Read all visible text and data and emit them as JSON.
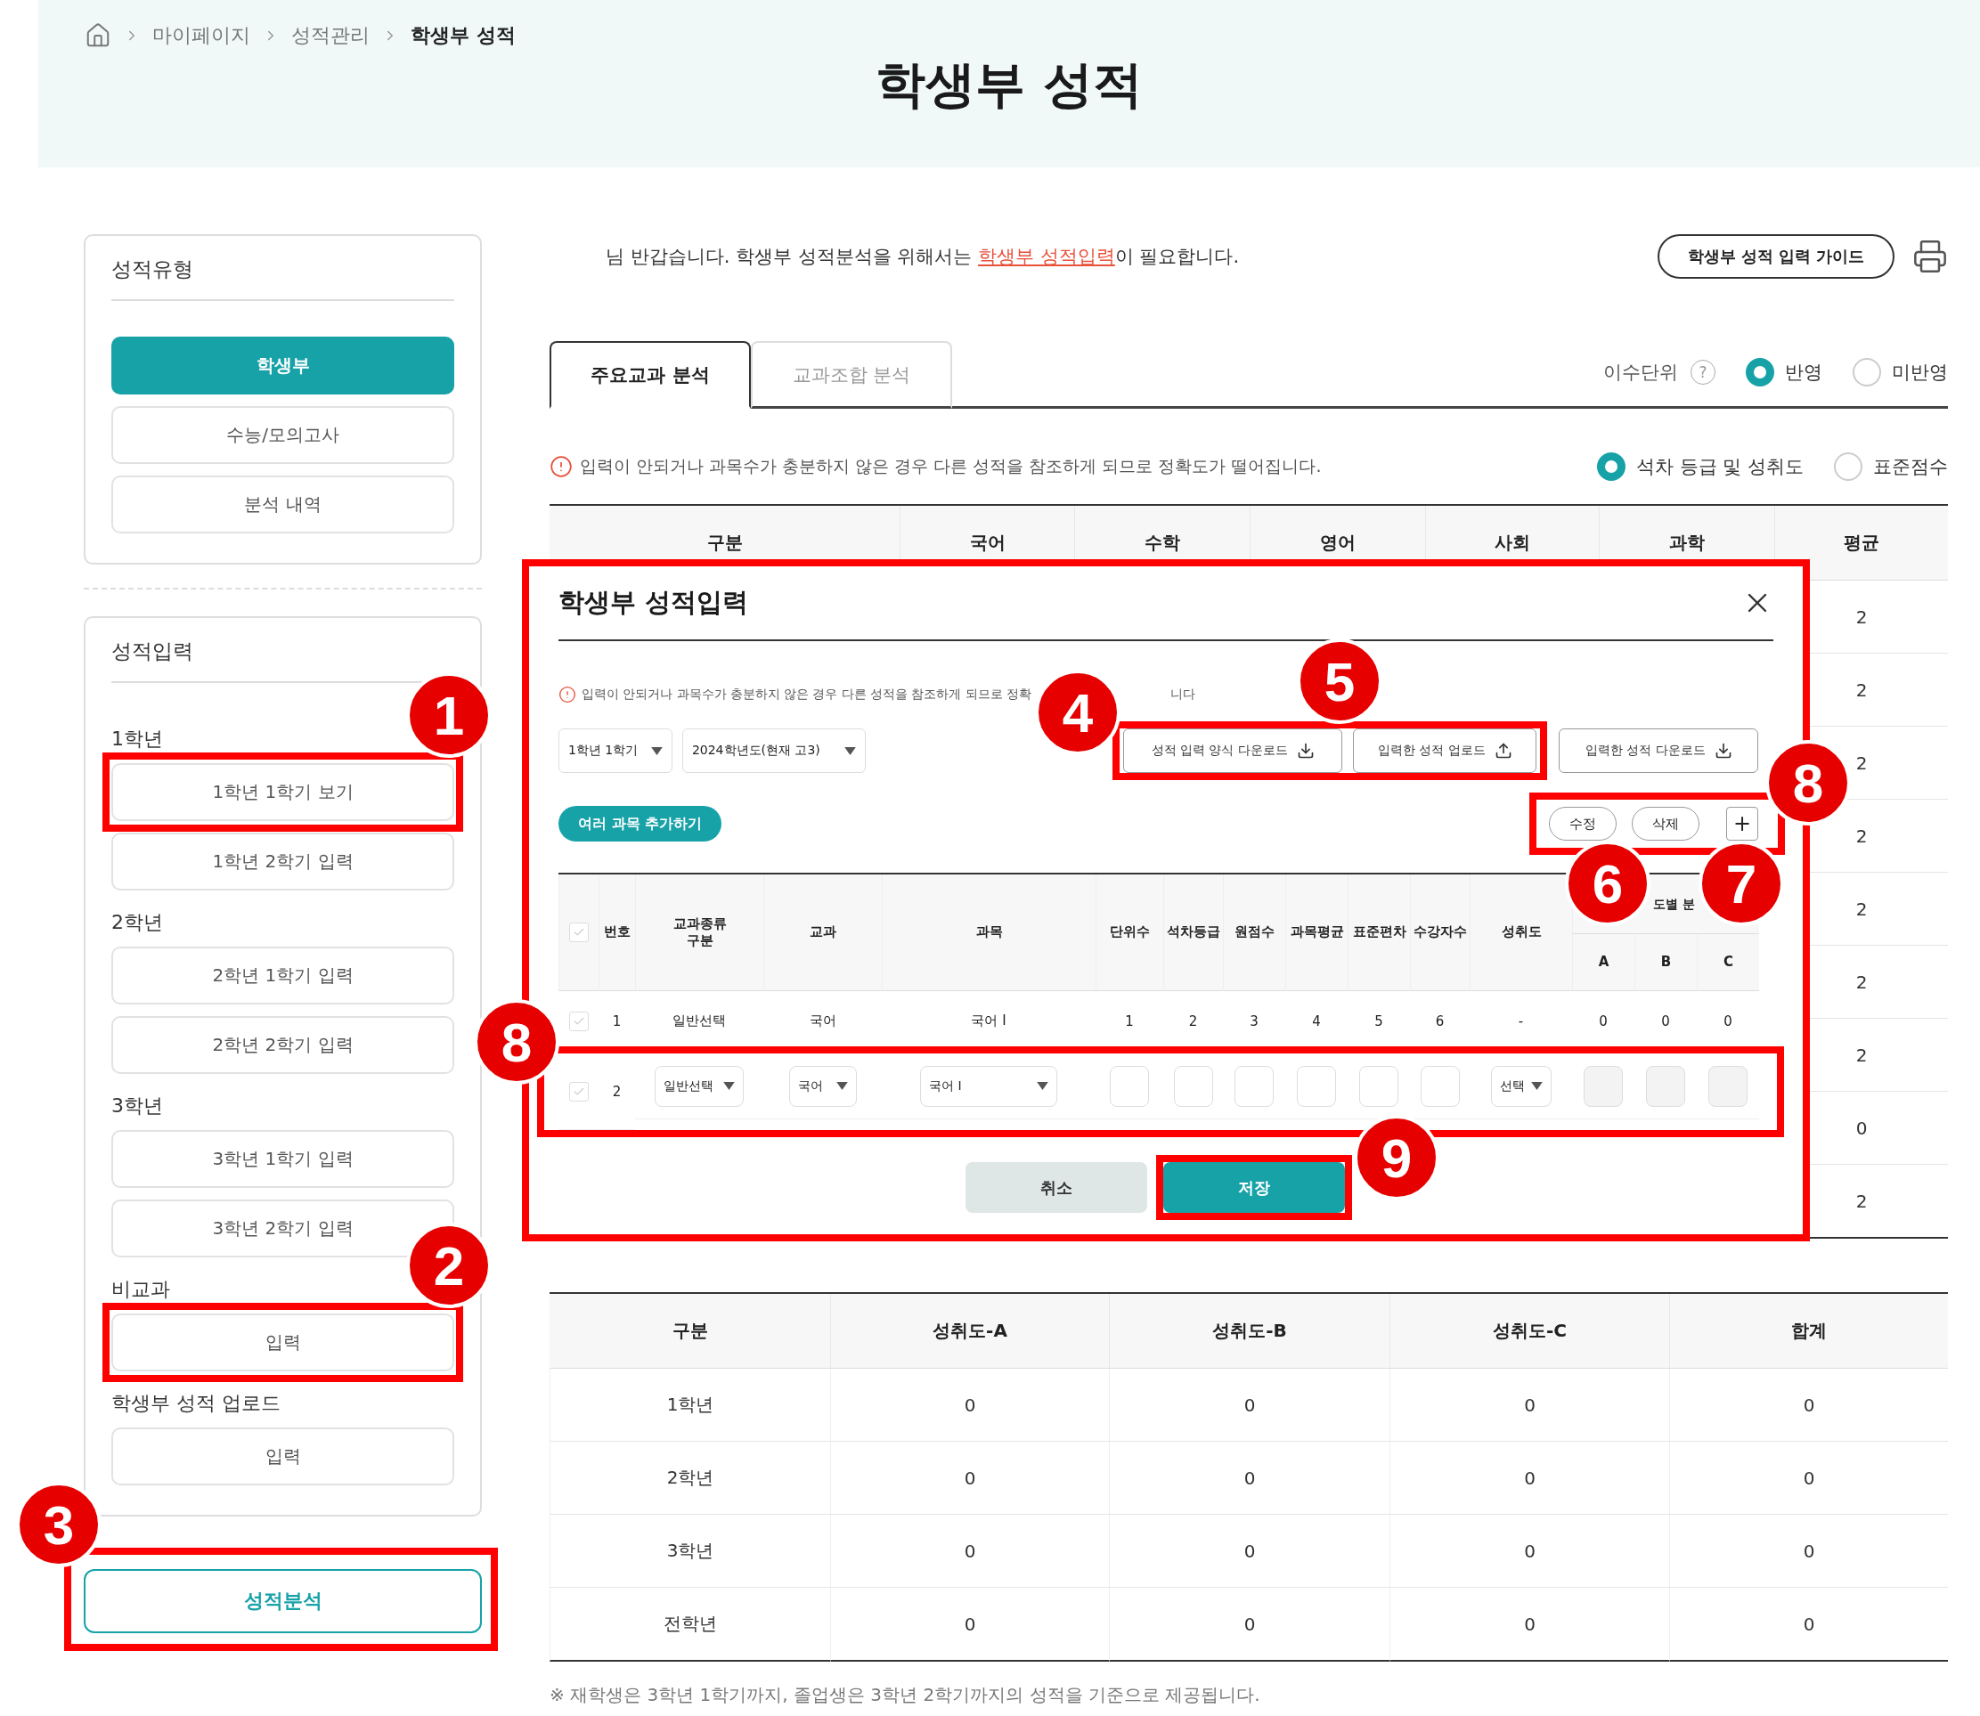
{
  "breadcrumb": [
    "마이페이지",
    "성적관리",
    "학생부 성적"
  ],
  "page_title": "학생부 성적",
  "sidebar": {
    "type_menu": {
      "title": "성적유형",
      "items": [
        {
          "label": "학생부",
          "selected": true
        },
        {
          "label": "수능/모의고사",
          "selected": false
        },
        {
          "label": "분석 내역",
          "selected": false
        }
      ]
    },
    "input_menu": {
      "title": "성적입력",
      "groups": [
        {
          "heading": "1학년",
          "items": [
            "1학년 1학기 보기",
            "1학년 2학기 입력"
          ]
        },
        {
          "heading": "2학년",
          "items": [
            "2학년 1학기 입력",
            "2학년 2학기 입력"
          ]
        },
        {
          "heading": "3학년",
          "items": [
            "3학년 1학기 입력",
            "3학년 2학기 입력"
          ]
        },
        {
          "heading": "비교과",
          "items": [
            "입력"
          ]
        },
        {
          "heading": "학생부 성적 업로드",
          "items": [
            "입력"
          ]
        }
      ]
    },
    "analysis_button": "성적분석"
  },
  "welcome": {
    "text_before": "님 반갑습니다. 학생부 성적분석을 위해서는 ",
    "link": "학생부 성적입력",
    "text_after": "이 필요합니다."
  },
  "guide_button": "학생부 성적 입력 가이드",
  "tabs": [
    {
      "label": "주요교과 분석",
      "selected": true
    },
    {
      "label": "교과조합 분석",
      "selected": false
    }
  ],
  "credit_option": {
    "label": "이수단위",
    "help": "?",
    "options": [
      {
        "label": "반영",
        "selected": true
      },
      {
        "label": "미반영",
        "selected": false
      }
    ]
  },
  "notice": "입력이 안되거나 과목수가 충분하지 않은 경우 다른 성적을 참조하게 되므로 정확도가 떨어집니다.",
  "score_option": {
    "options": [
      {
        "label": "석차 등급 및 성취도",
        "selected": true
      },
      {
        "label": "표준점수",
        "selected": false
      }
    ]
  },
  "subject_table": {
    "columns": [
      "구분",
      "국어",
      "수학",
      "영어",
      "사회",
      "과학",
      "평균"
    ],
    "rows": [
      {
        "average": "2"
      },
      {
        "average": "2"
      },
      {
        "average": "2"
      },
      {
        "average": "2"
      },
      {
        "average": "2"
      },
      {
        "average": "2"
      },
      {
        "average": "2"
      },
      {
        "average": "0"
      },
      {
        "average": "2"
      }
    ]
  },
  "modal": {
    "title": "학생부 성적입력",
    "warning": [
      "입력이 안되거나 과목수가 충분하지 않은 경우 다른 성적을 참조하게 되므로 정확",
      "니다"
    ],
    "selects": [
      "1학년 1학기",
      "2024학년도(현재 고3)"
    ],
    "file_buttons": [
      {
        "label": "성적 입력 양식 다운로드",
        "kind": "download"
      },
      {
        "label": "입력한 성적 업로드",
        "kind": "upload"
      },
      {
        "label": "입력한 성적 다운로드",
        "kind": "download"
      }
    ],
    "add_button": "여러 과목 추가하기",
    "row_actions": [
      {
        "label": "수정",
        "kind": "text"
      },
      {
        "label": "삭제",
        "kind": "text"
      },
      {
        "label": "+",
        "kind": "icon"
      }
    ],
    "columns": [
      "번호",
      "교과종류\n구분",
      "교과",
      "과목",
      "단위수",
      "석차등급",
      "원점수",
      "과목평균",
      "표준편차",
      "수강자수",
      "성취도"
    ],
    "group_header": "도별 분",
    "sub_columns": [
      "A",
      "B",
      "C"
    ],
    "rows": [
      {
        "kind": "view",
        "checked": false,
        "number": "1",
        "cells": [
          "일반선택",
          "국어",
          "국어 I",
          "1",
          "2",
          "3",
          "4",
          "5",
          "6",
          "-",
          "0",
          "0",
          "0"
        ]
      },
      {
        "kind": "edit",
        "checked": false,
        "number": "2",
        "selects": [
          "일반선택",
          "국어",
          "국어 I"
        ],
        "achievement": "선택"
      }
    ],
    "buttons": [
      {
        "label": "취소",
        "kind": "secondary"
      },
      {
        "label": "저장",
        "kind": "primary"
      }
    ]
  },
  "achievement_table": {
    "columns": [
      "구분",
      "성취도-A",
      "성취도-B",
      "성취도-C",
      "합계"
    ],
    "rows": [
      [
        "1학년",
        "0",
        "0",
        "0",
        "0"
      ],
      [
        "2학년",
        "0",
        "0",
        "0",
        "0"
      ],
      [
        "3학년",
        "0",
        "0",
        "0",
        "0"
      ],
      [
        "전학년",
        "0",
        "0",
        "0",
        "0"
      ]
    ]
  },
  "footnote": "※  재학생은 3학년 1학기까지, 졸업생은 3학년 2학기까지의 성적을 기준으로 제공됩니다.",
  "annotations": [
    "1",
    "2",
    "3",
    "4",
    "5",
    "8",
    "6",
    "7",
    "8",
    "9"
  ]
}
